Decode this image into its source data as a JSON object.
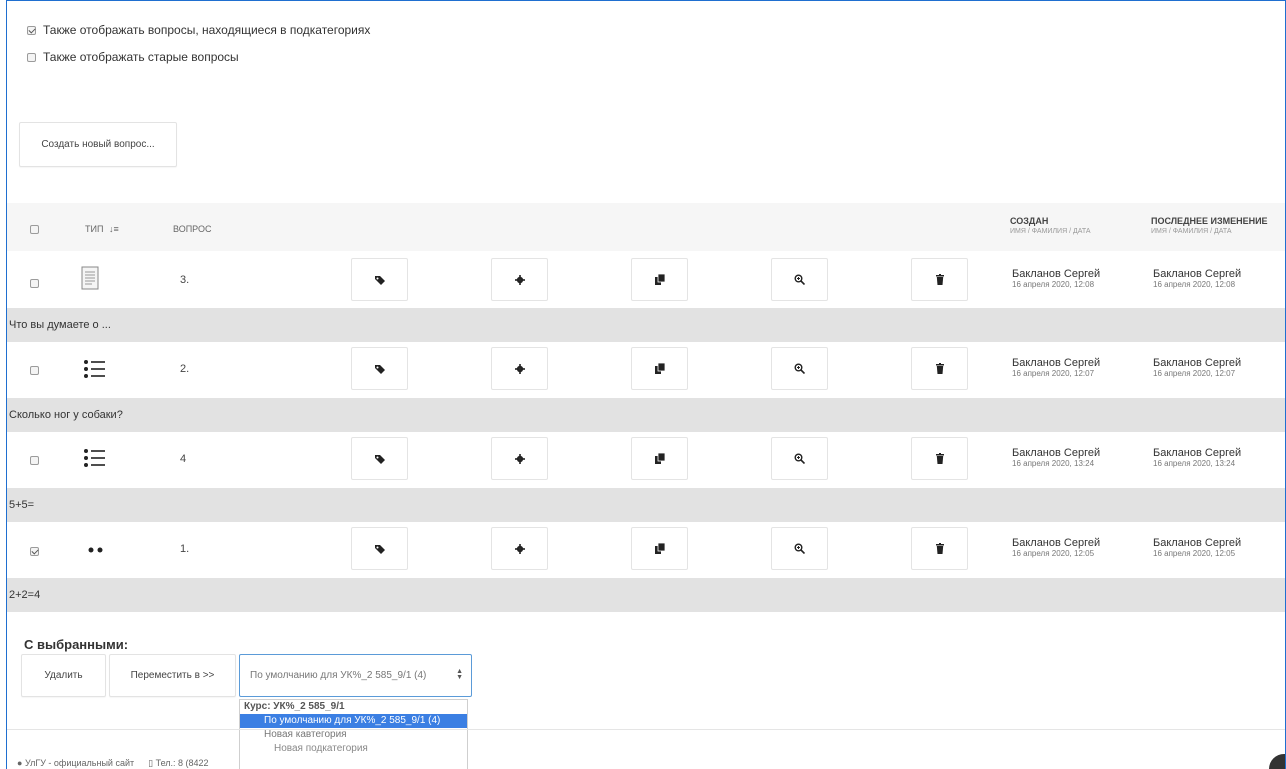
{
  "options": {
    "show_subcategories": {
      "label": "Также отображать вопросы, находящиеся в подкатегориях",
      "checked": true
    },
    "show_old": {
      "label": "Также отображать старые вопросы",
      "checked": false
    }
  },
  "create_button": "Создать новый вопрос...",
  "table": {
    "headers": {
      "type": "ТИП",
      "question": "ВОПРОС",
      "created": "СОЗДАН",
      "created_sub": "ИМЯ / ФАМИЛИЯ / ДАТА",
      "modified": "ПОСЛЕДНЕЕ ИЗМЕНЕНИЕ",
      "modified_sub": "ИМЯ / ФАМИЛИЯ / ДАТА"
    },
    "rows": [
      {
        "checked": false,
        "type_icon": "essay-icon",
        "name": "3.",
        "text": "Что вы думаете о ...",
        "created_by": "Бакланов Сергей",
        "created_date": "16 апреля 2020, 12:08",
        "modified_by": "Бакланов Сергей",
        "modified_date": "16 апреля 2020, 12:08"
      },
      {
        "checked": false,
        "type_icon": "multichoice-icon",
        "name": "2.",
        "text": "Сколько ног у собаки?",
        "created_by": "Бакланов Сергей",
        "created_date": "16 апреля 2020, 12:07",
        "modified_by": "Бакланов Сергей",
        "modified_date": "16 апреля 2020, 12:07"
      },
      {
        "checked": false,
        "type_icon": "multichoice-icon",
        "name": "4",
        "text": "5+5=",
        "created_by": "Бакланов Сергей",
        "created_date": "16 апреля 2020, 13:24",
        "modified_by": "Бакланов Сергей",
        "modified_date": "16 апреля 2020, 13:24"
      },
      {
        "checked": true,
        "type_icon": "truefalse-icon",
        "name": "1.",
        "text": "2+2=4",
        "created_by": "Бакланов Сергей",
        "created_date": "16 апреля 2020, 12:05",
        "modified_by": "Бакланов Сергей",
        "modified_date": "16 апреля 2020, 12:05"
      }
    ],
    "action_icons": [
      "tag-icon",
      "gear-icon",
      "copy-icon",
      "zoom-in-icon",
      "trash-icon"
    ]
  },
  "bulk": {
    "title": "С выбранными:",
    "delete": "Удалить",
    "move": "Переместить в >>",
    "select_value": "По умолчанию для УК%_2 585_9/1 (4)",
    "options": {
      "group": "Курс: УК%_2 585_9/1",
      "selected": "По умолчанию для УК%_2 585_9/1 (4)",
      "cat1": "Новая кавтегория",
      "cat2": "Новая подкатегория"
    }
  },
  "footer": {
    "site": "УлГУ - официальный сайт",
    "phone": "Тел.: 8 (8422"
  },
  "colors": {
    "accent": "#1f6fd0",
    "selected": "#3b7fe3",
    "row_text_bg": "#e2e2e2"
  }
}
